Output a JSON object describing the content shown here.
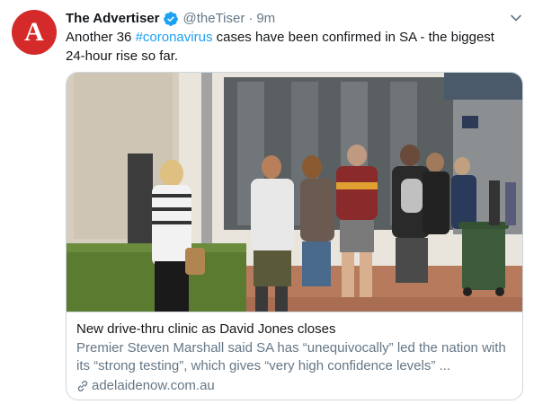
{
  "author": {
    "avatar_letter": "A",
    "display_name": "The Advertiser",
    "handle": "@theTiser",
    "separator": "·",
    "time": "9m",
    "verified": true
  },
  "tweet": {
    "text_before": "Another 36 ",
    "hashtag": "#coronavirus",
    "text_after": " cases have been confirmed in SA - the biggest 24-hour rise so far."
  },
  "card": {
    "image_icon": "photo-people-queue-outside-clinic",
    "title": "New drive-thru clinic as David Jones closes",
    "description": "Premier Steven Marshall said SA has “unequivocally” led the nation with its “strong testing”, which gives “very high confidence levels” ...",
    "domain": "adelaidenow.com.au"
  },
  "icons": {
    "verified": "verified-badge-icon",
    "caret": "chevron-down-icon",
    "link": "link-icon"
  },
  "colors": {
    "accent": "#1da1f2",
    "avatar_bg": "#d42a2a",
    "secondary_text": "#657786",
    "border": "#ccd6dd"
  }
}
